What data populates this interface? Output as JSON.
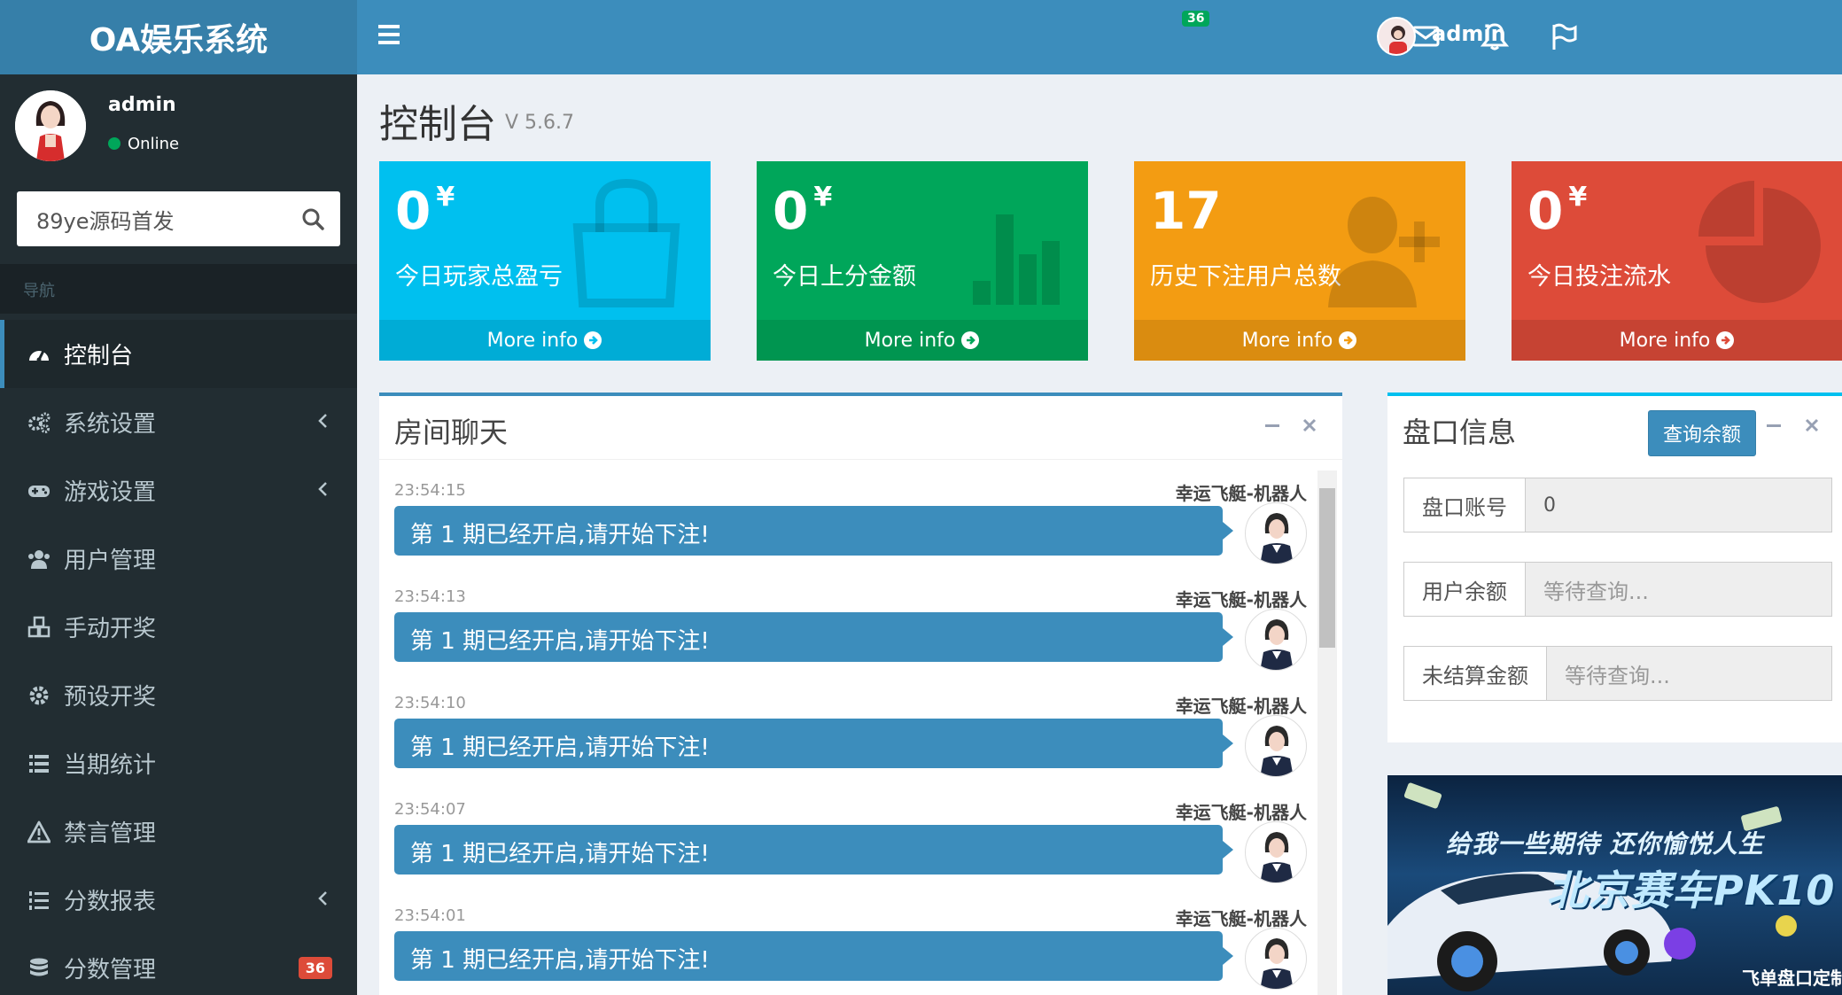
{
  "app": {
    "logo": "OA娱乐系统"
  },
  "topbar": {
    "mail_count": "36",
    "user_name": "admin"
  },
  "sidebar": {
    "user_name": "admin",
    "user_status": "Online",
    "search_value": "89ye源码首发",
    "nav_header": "导航",
    "items": [
      {
        "label": "控制台",
        "icon": "dashboard-icon"
      },
      {
        "label": "系统设置",
        "icon": "cogs-icon"
      },
      {
        "label": "游戏设置",
        "icon": "gamepad-icon"
      },
      {
        "label": "用户管理",
        "icon": "users-icon"
      },
      {
        "label": "手动开奖",
        "icon": "cubes-icon"
      },
      {
        "label": "预设开奖",
        "icon": "gear-icon"
      },
      {
        "label": "当期统计",
        "icon": "list-icon"
      },
      {
        "label": "禁言管理",
        "icon": "warning-icon"
      },
      {
        "label": "分数报表",
        "icon": "list-ol-icon"
      },
      {
        "label": "分数管理",
        "icon": "database-icon",
        "badge": "36"
      }
    ]
  },
  "page": {
    "title": "控制台",
    "version": "V 5.6.7"
  },
  "stat_boxes": [
    {
      "value": "0",
      "unit": "¥",
      "label": "今日玩家总盈亏",
      "footer": "More info",
      "color": "#00c0ef",
      "icon": "shopping-bag-icon"
    },
    {
      "value": "0",
      "unit": "¥",
      "label": "今日上分金额",
      "footer": "More info",
      "color": "#00a65a",
      "icon": "bar-chart-icon"
    },
    {
      "value": "17",
      "unit": "",
      "label": "历史下注用户总数",
      "footer": "More info",
      "color": "#f39c12",
      "icon": "user-plus-icon"
    },
    {
      "value": "0",
      "unit": "¥",
      "label": "今日投注流水",
      "footer": "More info",
      "color": "#dd4b39",
      "icon": "pie-chart-icon"
    }
  ],
  "chat": {
    "title": "房间聊天",
    "messages": [
      {
        "time": "23:54:15",
        "sender": "幸运飞艇-机器人",
        "text": "第 1 期已经开启,请开始下注!"
      },
      {
        "time": "23:54:13",
        "sender": "幸运飞艇-机器人",
        "text": "第 1 期已经开启,请开始下注!"
      },
      {
        "time": "23:54:10",
        "sender": "幸运飞艇-机器人",
        "text": "第 1 期已经开启,请开始下注!"
      },
      {
        "time": "23:54:07",
        "sender": "幸运飞艇-机器人",
        "text": "第 1 期已经开启,请开始下注!"
      },
      {
        "time": "23:54:01",
        "sender": "幸运飞艇-机器人",
        "text": "第 1 期已经开启,请开始下注!"
      }
    ]
  },
  "pankou": {
    "title": "盘口信息",
    "query_button": "查询余额",
    "rows": [
      {
        "label": "盘口账号",
        "value": "0",
        "placeholder": false
      },
      {
        "label": "用户余额",
        "value": "等待查询...",
        "placeholder": true
      },
      {
        "label": "未结算金额",
        "value": "等待查询...",
        "placeholder": true
      }
    ]
  },
  "ad": {
    "line1": "给我一些期待 还你愉悦人生",
    "line2": "北京赛车PK10",
    "line3": "飞单盘口定制"
  }
}
